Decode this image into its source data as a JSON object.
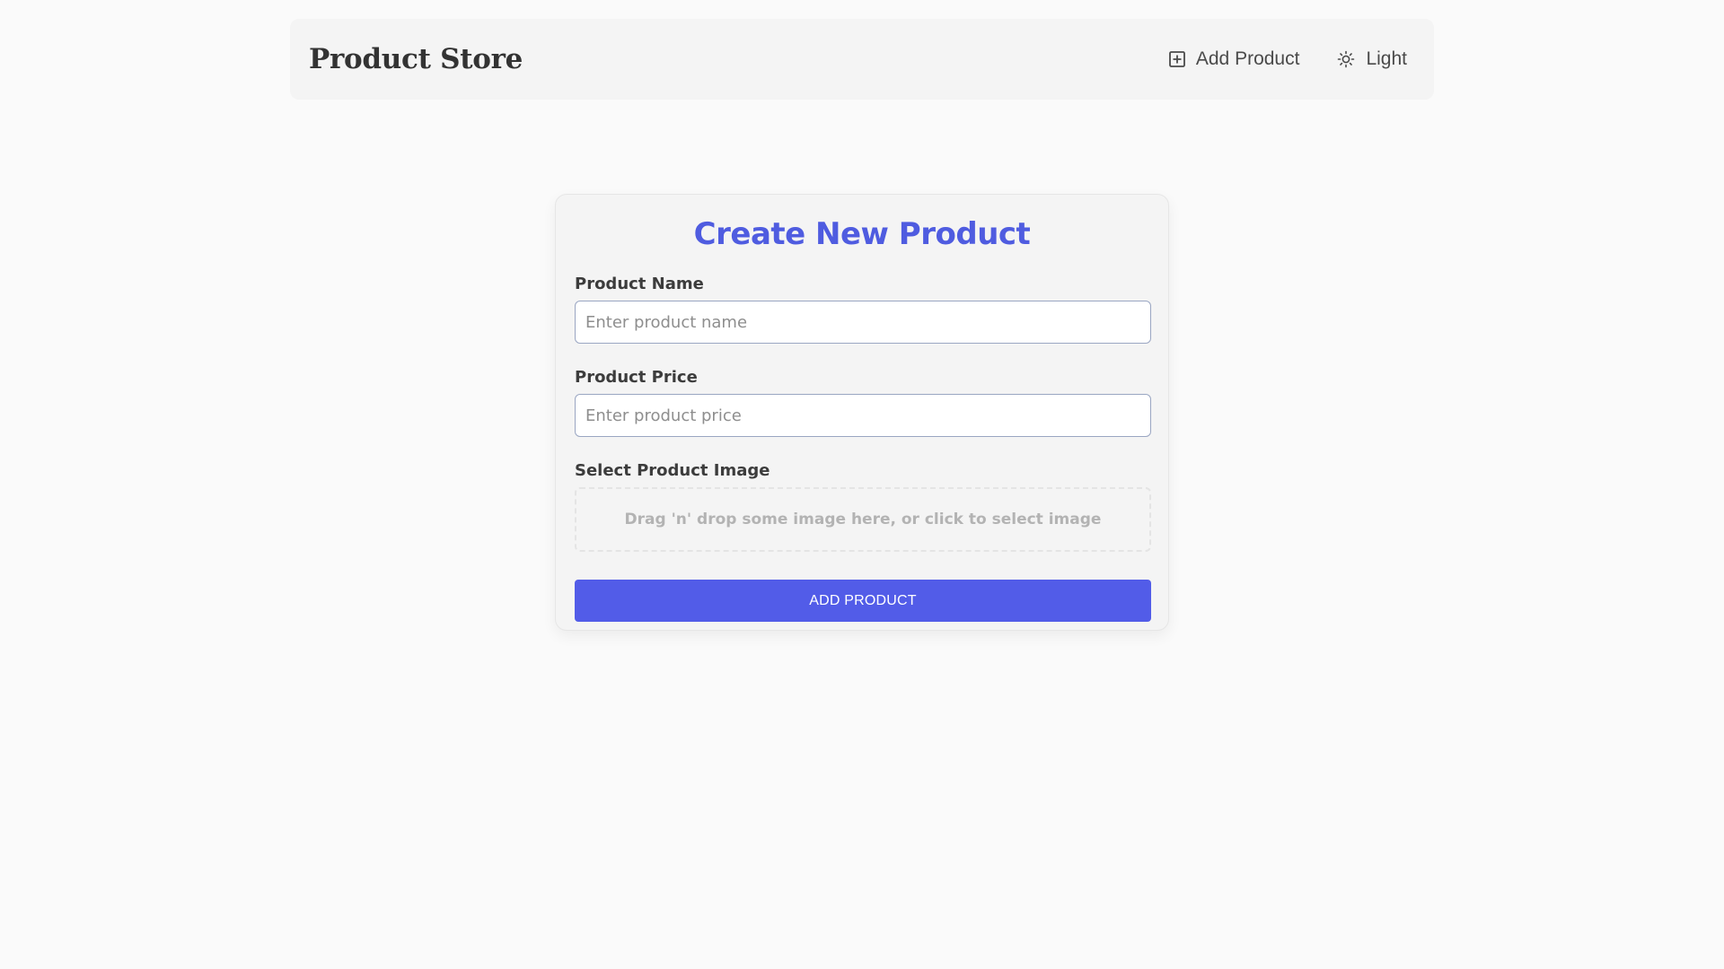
{
  "navbar": {
    "brand": "Product Store",
    "add_product_label": "Add Product",
    "add_product_icon": "plus-square-icon",
    "theme_label": "Light",
    "theme_icon": "sun-icon"
  },
  "form": {
    "title": "Create New Product",
    "name_label": "Product Name",
    "name_value": "",
    "name_placeholder": "Enter product name",
    "price_label": "Product Price",
    "price_value": "",
    "price_placeholder": "Enter product price",
    "image_label": "Select Product Image",
    "dropzone_text": "Drag 'n' drop some image here, or click to select image",
    "submit_label": "ADD PRODUCT"
  },
  "colors": {
    "accent": "#525ce8",
    "title": "#4f5ce0",
    "background": "#fafafa",
    "surface": "#f4f4f4"
  }
}
